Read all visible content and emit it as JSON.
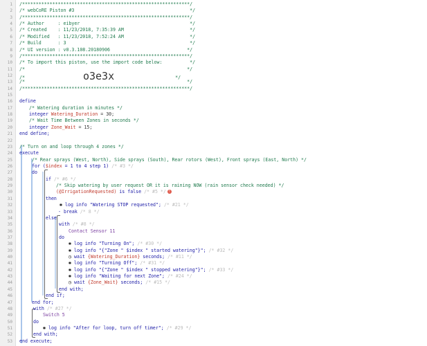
{
  "piston": {
    "header_rule": "/*************************************************************/",
    "header_name": "/* webCoRE Piston #3                                          */",
    "author": "/* Author     : eibyer                                        */",
    "created": "/* Created    : 11/23/2018, 7:35:39 AM                        */",
    "modified": "/* Modified   : 11/23/2018, 7:52:24 AM                        */",
    "build": "/* Build      : 3                                             */",
    "ui_version": "/* UI version : v0.3.108.20180906                            */",
    "import_note": "/* To import this piston, use the import code below:          */",
    "blank_comment": "/*                                                           */",
    "import_prefix": "/*",
    "import_code": "o3e3x",
    "import_suffix": "*/"
  },
  "code": {
    "define": "define",
    "watering_comment": "/* Watering duration in minutes */",
    "integer_kw": "integer",
    "watering_var": "Watering_Duration",
    "watering_val": "= 30;",
    "wait_comment": "/* Wait Time Between Zones in seconds */",
    "zone_var": "Zone_Wait",
    "zone_val": "= 15;",
    "end_define": "end define;",
    "turn_on_comment": "/* Turn on and loop through 4 zones */",
    "execute": "execute",
    "sprays_comment": "/* Rear sprays (West, North), Side sprays (South), Rear rotors (West), Front sprays (East, North) */",
    "for_prefix": "for (",
    "index_var": "$index",
    "for_range": "= 1 to 4 step 1)",
    "for_tag": "/* #3 */",
    "do": "do",
    "if": "if",
    "if_tag": "/* #6 */",
    "skip_comment": "/* Skip watering by user request OR it is raining NOW (rain sensor check needed) */",
    "irrigation_var": "(@IrrigationRequested)",
    "is_false": "is false",
    "cond_tag": "/* #5 */",
    "err_mark": "!",
    "then": "then",
    "log_info": "log info",
    "stop_msg": "\"Watering STOP requested\";",
    "stop_tag": "/* #21 */",
    "break": "- break",
    "break_tag": "/* 8 */",
    "else": "else",
    "with": "with",
    "with_tag": "/* #8 */",
    "contact_sensor": "Contact Sensor 11",
    "turning_on": "\"Turning On\";",
    "turning_on_tag": "/* #30 */",
    "zone_started": "\"{\"Zone \" $index \" started watering\"}\";",
    "zone_started_tag": "/* #32 */",
    "wait_kw": "wait",
    "watering_expr": "{Watering_Duration}",
    "minutes": "minutes;",
    "seconds": "seconds;",
    "wait1_tag": "/* #11 */",
    "turning_off": "\"Turning Off\";",
    "turning_off_tag": "/* #31 */",
    "zone_stopped": "\"{\"Zone \" $index \" stopped watering\"}\";",
    "zone_stopped_tag": "/* #33 */",
    "waiting_next": "\"Waiting for next Zone\";",
    "waiting_next_tag": "/* #24 */",
    "zone_wait_expr": "{Zone_Wait}",
    "wait2_tag": "/* #15 */",
    "end_with": "end with;",
    "end_if": "end if;",
    "end_for": "end for;",
    "with2_tag": "/* #27 */",
    "switch_5": "Switch 5",
    "after_loop": "\"After for loop, turn off timer\";",
    "after_loop_tag": "/* #29 */",
    "end_execute": "end execute;"
  },
  "icons": {
    "log": "bug-icon",
    "wait": "clock-icon"
  },
  "colors": {
    "keyword": "#1a1aa6",
    "comment": "#1f7a4d",
    "variable": "#c0392b",
    "device": "#7a3ea0",
    "guide_bar": "#a9c5ea"
  }
}
